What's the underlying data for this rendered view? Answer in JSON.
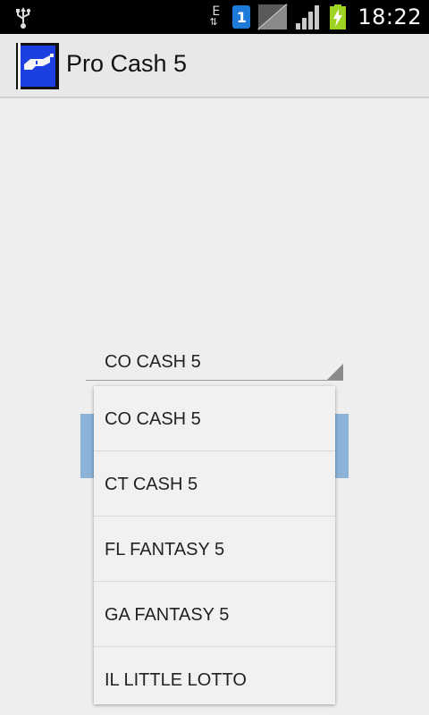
{
  "status_bar": {
    "network_letter": "E",
    "sim_number": "1",
    "time": "18:22",
    "icons": [
      "usb-icon",
      "data-arrows-icon",
      "sim-icon",
      "signal-icon",
      "battery-charging-icon"
    ]
  },
  "action_bar": {
    "title": "Pro Cash 5",
    "logo_icon": "app-logo-icon"
  },
  "spinner": {
    "selected": "CO CASH 5"
  },
  "dropdown": {
    "items": [
      {
        "label": "CO CASH 5"
      },
      {
        "label": "CT CASH 5"
      },
      {
        "label": "FL FANTASY 5"
      },
      {
        "label": "GA FANTASY 5"
      },
      {
        "label": "IL LITTLE LOTTO"
      }
    ]
  },
  "colors": {
    "status_bar_bg": "#000000",
    "action_bar_bg": "#e8e8e8",
    "page_bg": "#eeeeef",
    "button_bg": "#8cb4d8",
    "sim_badge": "#1e7ad8",
    "battery_green": "#9fd321"
  }
}
